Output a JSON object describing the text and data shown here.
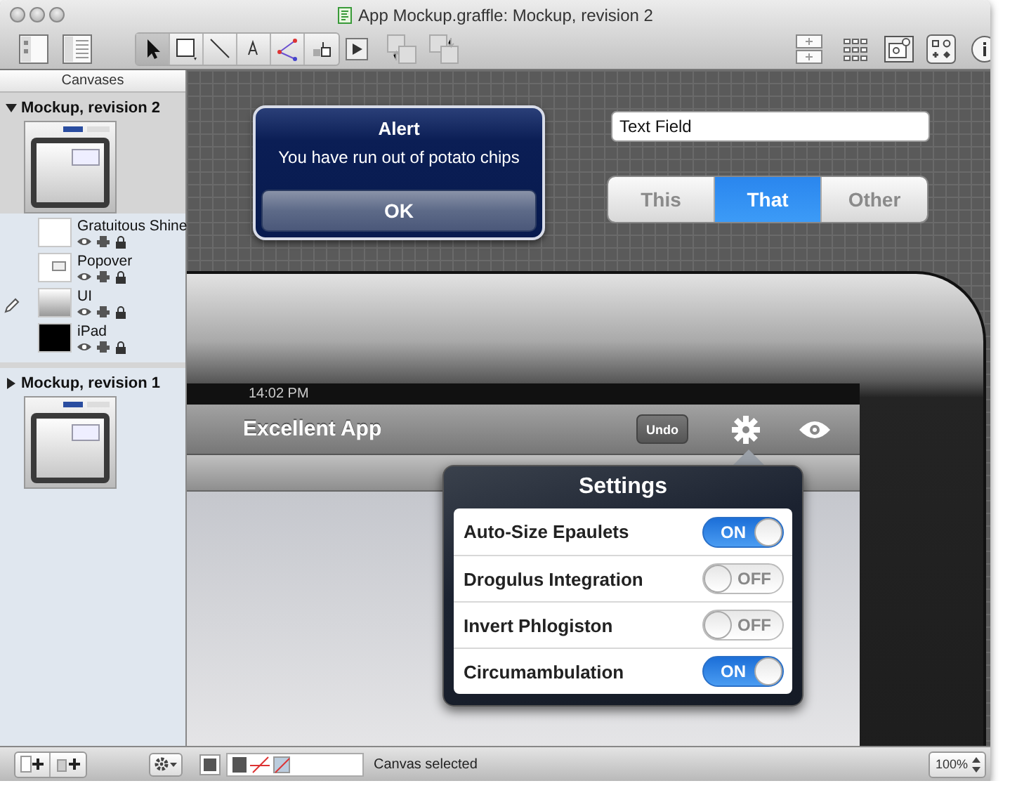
{
  "window": {
    "title": "App Mockup.graffle: Mockup, revision 2"
  },
  "sidebar": {
    "header": "Canvases",
    "canvases": [
      {
        "name": "Mockup, revision 2",
        "expanded": true,
        "selected": true,
        "layers": [
          {
            "name": "Gratuitous Shine",
            "kind": "blank",
            "current": false
          },
          {
            "name": "Popover",
            "kind": "popover",
            "current": false
          },
          {
            "name": "UI",
            "kind": "gradient",
            "current": true
          },
          {
            "name": "iPad",
            "kind": "dark",
            "current": false
          }
        ]
      },
      {
        "name": "Mockup, revision 1",
        "expanded": false,
        "selected": false
      }
    ]
  },
  "canvas": {
    "alert": {
      "title": "Alert",
      "message": "You have run out of potato chips",
      "button": "OK"
    },
    "text_field": {
      "value": "Text Field"
    },
    "segments": [
      {
        "label": "This",
        "selected": false
      },
      {
        "label": "That",
        "selected": true
      },
      {
        "label": "Other",
        "selected": false
      }
    ],
    "ipad": {
      "time": "14:02 PM",
      "app_title": "Excellent App",
      "undo_button": "Undo",
      "popover": {
        "title": "Settings",
        "rows": [
          {
            "label": "Auto-Size Epaulets",
            "on": true,
            "switch_text": "ON"
          },
          {
            "label": "Drogulus Integration",
            "on": false,
            "switch_text": "OFF"
          },
          {
            "label": "Invert Phlogiston",
            "on": false,
            "switch_text": "OFF"
          },
          {
            "label": "Circumambulation",
            "on": true,
            "switch_text": "ON"
          }
        ]
      }
    }
  },
  "status_bar": {
    "message": "Canvas selected",
    "zoom": "100%"
  }
}
